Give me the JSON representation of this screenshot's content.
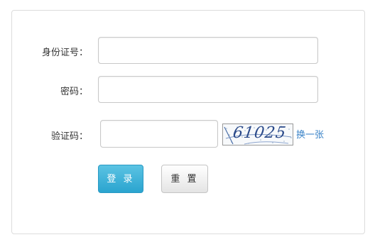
{
  "form": {
    "id_label": "身份证号：",
    "id_value": "",
    "password_label": "密码：",
    "password_value": "",
    "captcha_label": "验证码：",
    "captcha_value": "",
    "captcha_text": "61025",
    "refresh_label": "换一张",
    "login_label": "登 录",
    "reset_label": "重 置"
  },
  "colors": {
    "login_button": "#2aa4cf",
    "refresh_link": "#3a83c8",
    "captcha_text": "#2b4a8a"
  }
}
